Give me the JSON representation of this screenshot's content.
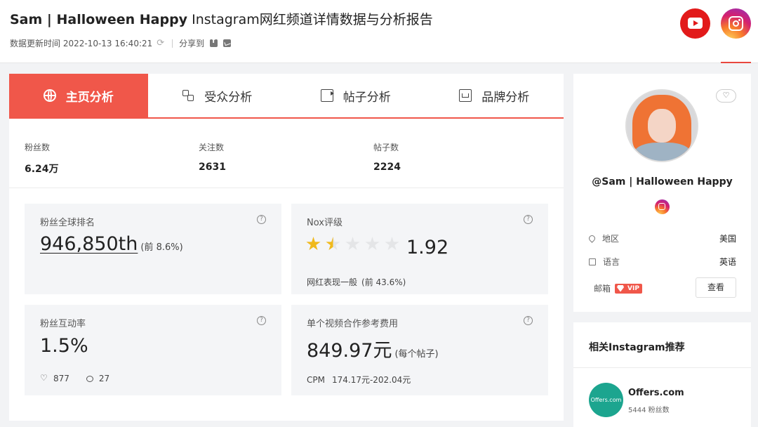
{
  "header": {
    "channel_name": "Sam | Halloween Happy",
    "title_suffix": " Instagram网红频道详情数据与分析报告",
    "updated_label": "数据更新时间 2022-10-13 16:40:21",
    "share_label": "分享到"
  },
  "tabs": [
    {
      "label": "主页分析",
      "icon": "globe-icon",
      "active": true
    },
    {
      "label": "受众分析",
      "icon": "audience-icon",
      "active": false
    },
    {
      "label": "帖子分析",
      "icon": "video-icon",
      "active": false
    },
    {
      "label": "品牌分析",
      "icon": "brand-icon",
      "active": false
    }
  ],
  "stats": [
    {
      "label": "粉丝数",
      "value": "6.24万"
    },
    {
      "label": "关注数",
      "value": "2631"
    },
    {
      "label": "帖子数",
      "value": "2224"
    }
  ],
  "cards": {
    "rank": {
      "title": "粉丝全球排名",
      "value": "946,850th",
      "note": "(前 8.6%)"
    },
    "nox": {
      "title": "Nox评级",
      "stars": 1.5,
      "score": "1.92",
      "footnote": "网红表现一般",
      "footnote_pct": "(前 43.6%)"
    },
    "engagement": {
      "title": "粉丝互动率",
      "value": "1.5%",
      "likes": "877",
      "comments": "27"
    },
    "cost": {
      "title": "单个视频合作参考费用",
      "value": "849.97元",
      "unit": "(每个帖子)",
      "cpm_label": "CPM",
      "cpm_value": "174.17元-202.04元"
    }
  },
  "profile": {
    "handle": "@Sam | Halloween Happy",
    "region_label": "地区",
    "region_value": "美国",
    "language_label": "语言",
    "language_value": "英语",
    "email_label": "邮箱",
    "vip_label": "VIP",
    "view_button": "查看",
    "fav_icon": "♡"
  },
  "recommend": {
    "title": "相关Instagram推荐",
    "items": [
      {
        "name": "Offers.com",
        "followers": "5444 粉丝数",
        "logo_text": "Offers.com"
      }
    ]
  },
  "colors": {
    "accent": "#f0574a",
    "star": "#f0b91c",
    "youtube": "#e21a1a"
  }
}
